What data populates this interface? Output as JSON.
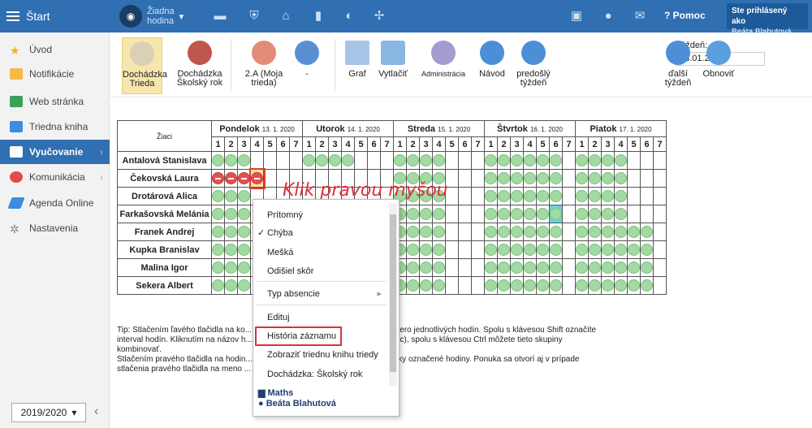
{
  "topbar": {
    "start_label": "Štart",
    "lesson_label_1": "Žiadna",
    "lesson_label_2": "hodina",
    "help_label": "Pomoc",
    "user_line1": "Ste prihlásený ako",
    "user_line2": "Beáta Blahutová",
    "accent": "#2f6fb2"
  },
  "sidebar": {
    "items": [
      {
        "label": "Úvod"
      },
      {
        "label": "Notifikácie"
      },
      {
        "label": "Web stránka"
      },
      {
        "label": "Triedna kniha"
      },
      {
        "label": "Vyučovanie"
      },
      {
        "label": "Komunikácia"
      },
      {
        "label": "Agenda Online"
      },
      {
        "label": "Nastavenia"
      }
    ],
    "year": "2019/2020"
  },
  "toolbar": {
    "dochadzka_trieda": "Dochádzka Trieda",
    "dochadzka_skolsky": "Dochádzka Školský rok",
    "trieda": "2.A (Moja trieda)",
    "dash": "-",
    "graf": "Graf",
    "vytlacit": "Vytlačiť",
    "administracia": "Administrácia",
    "navod": "Návod",
    "predosly": "predošlý týždeň",
    "tyzden_label": "Týždeň:",
    "tyzden_value": "13.01.2020",
    "dalsi": "ďalší týždeň",
    "obnovit": "Obnoviť"
  },
  "grid": {
    "header_ziaci": "Žiaci",
    "days": [
      {
        "name": "Pondelok",
        "date": "13. 1. 2020"
      },
      {
        "name": "Utorok",
        "date": "14. 1. 2020"
      },
      {
        "name": "Streda",
        "date": "15. 1. 2020"
      },
      {
        "name": "Štvrtok",
        "date": "16. 1. 2020"
      },
      {
        "name": "Piatok",
        "date": "17. 1. 2020"
      }
    ],
    "students": [
      "Antalová Stanislava",
      "Čekovská Laura",
      "Drotárová Alica",
      "Farkašovská Melánia",
      "Franek Andrej",
      "Kupka Branislav",
      "Malina Igor",
      "Sekera Albert"
    ]
  },
  "annotation": "Klik pravou myšou",
  "context_menu": {
    "items": [
      "Prítomný",
      "Chýba",
      "Mešká",
      "Odišiel skôr",
      "Typ absencie",
      "Edituj",
      "História záznamu",
      "Zobraziť triednu knihu triedy",
      "Dochádzka: Školský rok"
    ],
    "footer_subject": "Maths",
    "footer_teacher": "Beáta Blahutová"
  },
  "tip": {
    "line1": "Tip: Stlačením ľavého tlačidla na ko... Spolu s klávesou Ctrl takto označíte viacero jednotlivých hodín. Spolu s klávesou Shift označíte",
    "line2": "interval hodín. Kliknutím na názov h... te celú skupinu hodín (riadok alebo stĺpec), spolu s klávesou Ctrl môžete tieto skupiny",
    "line3": "kombinovať.",
    "line4": "Stlačením pravého tlačidla na hodin... ť chýbanie študenta a iné akcie pre všetky označené hodiny. Ponuka sa otvorí aj v prípade",
    "line5": "stlačenia pravého tlačidla na meno ..."
  }
}
